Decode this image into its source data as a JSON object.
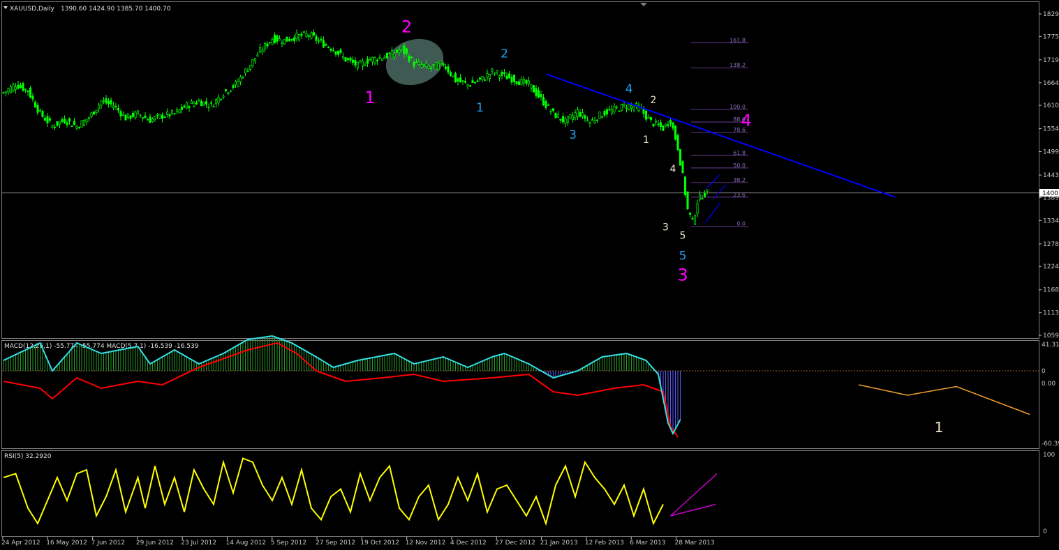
{
  "main": {
    "title": "XAUUSD,Daily",
    "ohlc": "1390.60 1424.90 1385.70 1400.70",
    "current_price_label": "1400"
  },
  "macd_panel": {
    "title": "MACD(12,26,1) -55.774 -55.774  MACD(5,7,1) -16.539 -16.539"
  },
  "rsi_panel": {
    "title": "RSI(5) 32.2920"
  },
  "colors": {
    "background": "#000000",
    "candle": "#00ff00",
    "grid_line": "#ffffff",
    "trendline": "#0000ff",
    "wave_magenta": "#ff00ff",
    "wave_cyan": "#1ea0f0",
    "wave_white": "#f0e6c8",
    "macd_fast": "#33e0e8",
    "macd_signal": "#ff0000",
    "macd_hist_pos": "#2a9a2a",
    "macd_hist_neg": "#5a5aff",
    "rsi_line": "#ffff00",
    "fib": "#7a4ab0",
    "projection_orange": "#f0a030",
    "projection_magenta": "#cc00cc"
  },
  "chart_data": [
    {
      "type": "candlestick",
      "title": "XAUUSD,Daily",
      "ylim": [
        1059,
        1829
      ],
      "y_ticks": [
        "1829",
        "1775",
        "1719",
        "1664",
        "1610",
        "1554",
        "1499",
        "1443",
        "1389",
        "1334",
        "1278",
        "1224",
        "1168",
        "1113",
        "1059"
      ],
      "x_ticks": [
        "24 Apr 2012",
        "16 May 2012",
        "7 Jun 2012",
        "29 Jun 2012",
        "23 Jul 2012",
        "14 Aug 2012",
        "5 Sep 2012",
        "27 Sep 2012",
        "19 Oct 2012",
        "12 Nov 2012",
        "4 Dec 2012",
        "27 Dec 2012",
        "21 Jan 2013",
        "12 Feb 2013",
        "6 Mar 2013",
        "28 Mar 2013"
      ],
      "close_path": [
        [
          0,
          1640
        ],
        [
          5,
          1660
        ],
        [
          10,
          1645
        ],
        [
          15,
          1590
        ],
        [
          20,
          1560
        ],
        [
          25,
          1575
        ],
        [
          30,
          1560
        ],
        [
          35,
          1580
        ],
        [
          40,
          1620
        ],
        [
          45,
          1610
        ],
        [
          50,
          1580
        ],
        [
          55,
          1590
        ],
        [
          60,
          1575
        ],
        [
          65,
          1585
        ],
        [
          70,
          1590
        ],
        [
          75,
          1610
        ],
        [
          80,
          1620
        ],
        [
          85,
          1610
        ],
        [
          90,
          1640
        ],
        [
          95,
          1660
        ],
        [
          100,
          1700
        ],
        [
          105,
          1740
        ],
        [
          110,
          1770
        ],
        [
          115,
          1765
        ],
        [
          120,
          1775
        ],
        [
          125,
          1780
        ],
        [
          130,
          1760
        ],
        [
          135,
          1745
        ],
        [
          140,
          1720
        ],
        [
          145,
          1705
        ],
        [
          150,
          1720
        ],
        [
          155,
          1725
        ],
        [
          160,
          1735
        ],
        [
          163,
          1745
        ],
        [
          168,
          1710
        ],
        [
          175,
          1700
        ],
        [
          180,
          1710
        ],
        [
          185,
          1670
        ],
        [
          190,
          1660
        ],
        [
          195,
          1670
        ],
        [
          200,
          1690
        ],
        [
          205,
          1680
        ],
        [
          210,
          1670
        ],
        [
          215,
          1660
        ],
        [
          220,
          1625
        ],
        [
          225,
          1590
        ],
        [
          230,
          1570
        ],
        [
          235,
          1595
        ],
        [
          240,
          1570
        ],
        [
          245,
          1590
        ],
        [
          250,
          1600
        ],
        [
          255,
          1610
        ],
        [
          260,
          1605
        ],
        [
          265,
          1570
        ],
        [
          270,
          1555
        ],
        [
          273,
          1575
        ],
        [
          276,
          1510
        ],
        [
          278,
          1440
        ],
        [
          280,
          1360
        ],
        [
          282,
          1330
        ],
        [
          284,
          1380
        ],
        [
          286,
          1395
        ],
        [
          288,
          1400
        ]
      ],
      "trendline": [
        [
          222,
          1685
        ],
        [
          365,
          1390
        ]
      ],
      "fibonacci": [
        {
          "level": "161.8",
          "price": 1760
        },
        {
          "level": "138.2",
          "price": 1700
        },
        {
          "level": "100.0",
          "price": 1600
        },
        {
          "level": "88.6",
          "price": 1570
        },
        {
          "level": "78.6",
          "price": 1545
        },
        {
          "level": "61.8",
          "price": 1490
        },
        {
          "level": "50.0",
          "price": 1460
        },
        {
          "level": "38.2",
          "price": 1425
        },
        {
          "level": "23.6",
          "price": 1390
        },
        {
          "level": "0.0",
          "price": 1320
        }
      ],
      "wave_labels": [
        {
          "text": "2",
          "color": "magenta",
          "bar": 165,
          "price": 1785
        },
        {
          "text": "1",
          "color": "magenta",
          "bar": 150,
          "price": 1615
        },
        {
          "text": "4",
          "color": "magenta",
          "bar": 304,
          "price": 1560
        },
        {
          "text": "3",
          "color": "magenta",
          "bar": 278,
          "price": 1190
        },
        {
          "text": "2",
          "color": "cyan",
          "bar": 205,
          "price": 1725
        },
        {
          "text": "1",
          "color": "cyan",
          "bar": 195,
          "price": 1595
        },
        {
          "text": "3",
          "color": "cyan",
          "bar": 233,
          "price": 1530
        },
        {
          "text": "4",
          "color": "cyan",
          "bar": 256,
          "price": 1640
        },
        {
          "text": "5",
          "color": "cyan",
          "bar": 278,
          "price": 1240
        },
        {
          "text": "2",
          "color": "white",
          "bar": 266,
          "price": 1615
        },
        {
          "text": "1",
          "color": "white",
          "bar": 263,
          "price": 1520
        },
        {
          "text": "4",
          "color": "white",
          "bar": 274,
          "price": 1450
        },
        {
          "text": "3",
          "color": "white",
          "bar": 271,
          "price": 1310
        },
        {
          "text": "5",
          "color": "white",
          "bar": 278,
          "price": 1290
        }
      ]
    },
    {
      "type": "line",
      "title": "MACD(12,26,1) -55.774 -55.774  MACD(5,7,1) -16.539 -16.539",
      "y_ticks": [
        "41.31",
        "0",
        "0.00",
        "-60.39"
      ],
      "fast_path": [
        [
          0,
          0.3
        ],
        [
          15,
          0.8
        ],
        [
          20,
          0.0
        ],
        [
          30,
          0.8
        ],
        [
          40,
          0.5
        ],
        [
          55,
          0.7
        ],
        [
          60,
          0.2
        ],
        [
          70,
          0.6
        ],
        [
          80,
          0.2
        ],
        [
          90,
          0.5
        ],
        [
          100,
          0.9
        ],
        [
          110,
          1.0
        ],
        [
          118,
          0.8
        ],
        [
          128,
          0.4
        ],
        [
          135,
          0.1
        ],
        [
          145,
          0.3
        ],
        [
          160,
          0.5
        ],
        [
          168,
          0.2
        ],
        [
          180,
          0.4
        ],
        [
          190,
          0.1
        ],
        [
          200,
          0.4
        ],
        [
          205,
          0.5
        ],
        [
          215,
          0.2
        ],
        [
          225,
          -0.2
        ],
        [
          235,
          0.0
        ],
        [
          245,
          0.4
        ],
        [
          255,
          0.5
        ],
        [
          263,
          0.3
        ],
        [
          268,
          -0.1
        ],
        [
          272,
          -1.5
        ],
        [
          274,
          -1.8
        ],
        [
          277,
          -1.4
        ]
      ],
      "signal_path": [
        [
          0,
          -0.3
        ],
        [
          15,
          -0.5
        ],
        [
          20,
          -0.8
        ],
        [
          30,
          -0.2
        ],
        [
          40,
          -0.5
        ],
        [
          55,
          -0.3
        ],
        [
          65,
          -0.4
        ],
        [
          80,
          0.1
        ],
        [
          100,
          0.6
        ],
        [
          112,
          0.8
        ],
        [
          120,
          0.5
        ],
        [
          128,
          0.0
        ],
        [
          140,
          -0.3
        ],
        [
          155,
          -0.2
        ],
        [
          168,
          -0.1
        ],
        [
          180,
          -0.3
        ],
        [
          200,
          -0.2
        ],
        [
          215,
          -0.1
        ],
        [
          225,
          -0.6
        ],
        [
          235,
          -0.7
        ],
        [
          250,
          -0.5
        ],
        [
          262,
          -0.4
        ],
        [
          270,
          -0.6
        ],
        [
          273,
          -1.6
        ],
        [
          276,
          -1.9
        ]
      ],
      "projection": [
        [
          350,
          -0.4
        ],
        [
          370,
          -0.7
        ],
        [
          390,
          -0.45
        ],
        [
          420,
          -1.25
        ]
      ],
      "projection_label": "1"
    },
    {
      "type": "line",
      "title": "RSI(5) 32.2920",
      "ylim": [
        0,
        100
      ],
      "y_ticks": [
        "100",
        "0"
      ],
      "series_path": [
        [
          0,
          70
        ],
        [
          5,
          75
        ],
        [
          10,
          30
        ],
        [
          14,
          10
        ],
        [
          18,
          40
        ],
        [
          22,
          70
        ],
        [
          26,
          40
        ],
        [
          30,
          75
        ],
        [
          34,
          80
        ],
        [
          38,
          20
        ],
        [
          42,
          45
        ],
        [
          46,
          80
        ],
        [
          50,
          25
        ],
        [
          55,
          70
        ],
        [
          58,
          30
        ],
        [
          62,
          85
        ],
        [
          66,
          35
        ],
        [
          70,
          70
        ],
        [
          74,
          25
        ],
        [
          78,
          80
        ],
        [
          82,
          55
        ],
        [
          86,
          35
        ],
        [
          90,
          90
        ],
        [
          94,
          50
        ],
        [
          98,
          95
        ],
        [
          102,
          90
        ],
        [
          106,
          60
        ],
        [
          110,
          40
        ],
        [
          114,
          70
        ],
        [
          118,
          35
        ],
        [
          122,
          80
        ],
        [
          126,
          30
        ],
        [
          130,
          15
        ],
        [
          134,
          45
        ],
        [
          138,
          55
        ],
        [
          142,
          25
        ],
        [
          146,
          75
        ],
        [
          150,
          40
        ],
        [
          154,
          70
        ],
        [
          158,
          85
        ],
        [
          162,
          30
        ],
        [
          166,
          15
        ],
        [
          170,
          45
        ],
        [
          174,
          60
        ],
        [
          178,
          15
        ],
        [
          182,
          35
        ],
        [
          186,
          70
        ],
        [
          190,
          40
        ],
        [
          194,
          75
        ],
        [
          198,
          25
        ],
        [
          202,
          55
        ],
        [
          206,
          60
        ],
        [
          210,
          40
        ],
        [
          214,
          20
        ],
        [
          218,
          45
        ],
        [
          222,
          10
        ],
        [
          226,
          60
        ],
        [
          230,
          85
        ],
        [
          234,
          45
        ],
        [
          238,
          90
        ],
        [
          242,
          70
        ],
        [
          246,
          55
        ],
        [
          250,
          35
        ],
        [
          254,
          60
        ],
        [
          258,
          20
        ],
        [
          262,
          55
        ],
        [
          266,
          10
        ],
        [
          270,
          35
        ]
      ],
      "projection": [
        [
          273,
          20
        ],
        [
          292,
          75
        ]
      ]
    }
  ]
}
